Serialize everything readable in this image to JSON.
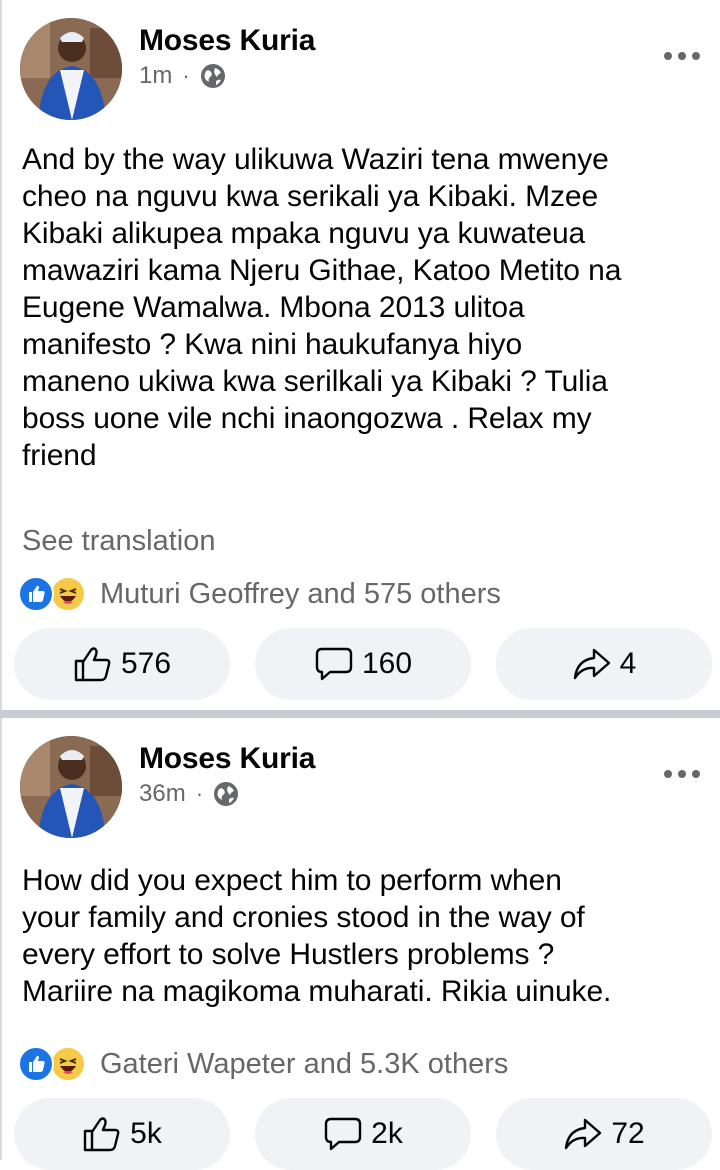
{
  "posts": [
    {
      "author": "Moses Kuria",
      "time": "1m",
      "separator": "·",
      "text_lines": [
        "And by the way ulikuwa Waziri tena mwenye",
        "cheo na nguvu kwa serikali ya Kibaki. Mzee",
        "Kibaki alikupea mpaka nguvu ya kuwateua",
        "mawaziri kama Njeru Githae, Katoo Metito na",
        "Eugene Wamalwa. Mbona 2013 ulitoa",
        "manifesto ? Kwa nini haukufanya hiyo",
        "maneno ukiwa kwa serilkali ya Kibaki ? Tulia",
        "boss uone vile nchi inaongozwa . Relax my",
        "friend"
      ],
      "see_translation": "See translation",
      "reactions_summary": "Muturi Geoffrey and 575 others",
      "like_count": "576",
      "comment_count": "160",
      "share_count": "4"
    },
    {
      "author": "Moses Kuria",
      "time": "36m",
      "separator": "·",
      "text_lines": [
        "How did you expect him to perform  when",
        "your family and cronies stood in the way of",
        "every effort to solve Hustlers problems ?",
        "Mariire na magikoma muharati. Rikia uinuke."
      ],
      "reactions_summary": "Gateri Wapeter and 5.3K others",
      "like_count": "5k",
      "comment_count": "2k",
      "share_count": "72"
    }
  ],
  "icons": {
    "globe": "globe-icon",
    "more": "more-options-icon",
    "like": "thumbs-up-icon",
    "comment": "comment-icon",
    "share": "share-icon",
    "reaction_like": "like-reaction-icon",
    "reaction_haha": "haha-reaction-icon"
  },
  "colors": {
    "like_blue": "#1b74e4",
    "haha_yellow": "#f7c948",
    "secondary_text": "#65676b",
    "button_bg": "#f0f2f5"
  }
}
